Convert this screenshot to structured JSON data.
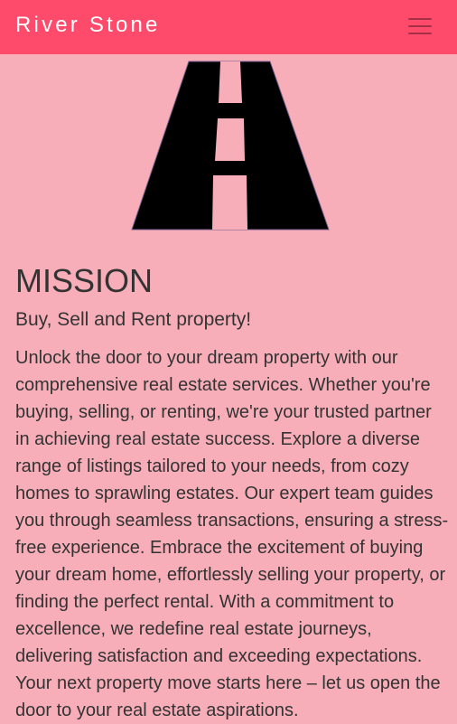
{
  "navbar": {
    "brand": "River Stone",
    "menu_icon": "hamburger-menu-icon"
  },
  "logo": {
    "icon": "road-logo-icon"
  },
  "mission": {
    "heading": "MISSION",
    "subheading": "Buy, Sell and Rent property!",
    "body": "Unlock the door to your dream property with our comprehensive real estate services. Whether you're buying, selling, or renting, we're your trusted partner in achieving real estate success. Explore a diverse range of listings tailored to your needs, from cozy homes to sprawling estates. Our expert team guides you through seamless transactions, ensuring a stress-free experience. Embrace the excitement of buying your dream home, effortlessly selling your property, or finding the perfect rental. With a commitment to excellence, we redefine real estate journeys, delivering satisfaction and exceeding expectations. Your next property move starts here – let us open the door to your real estate aspirations."
  },
  "colors": {
    "navbar": "#fe4a6b",
    "background": "#f8aeb9",
    "text": "#333333",
    "brand_text": "#ffffff"
  }
}
